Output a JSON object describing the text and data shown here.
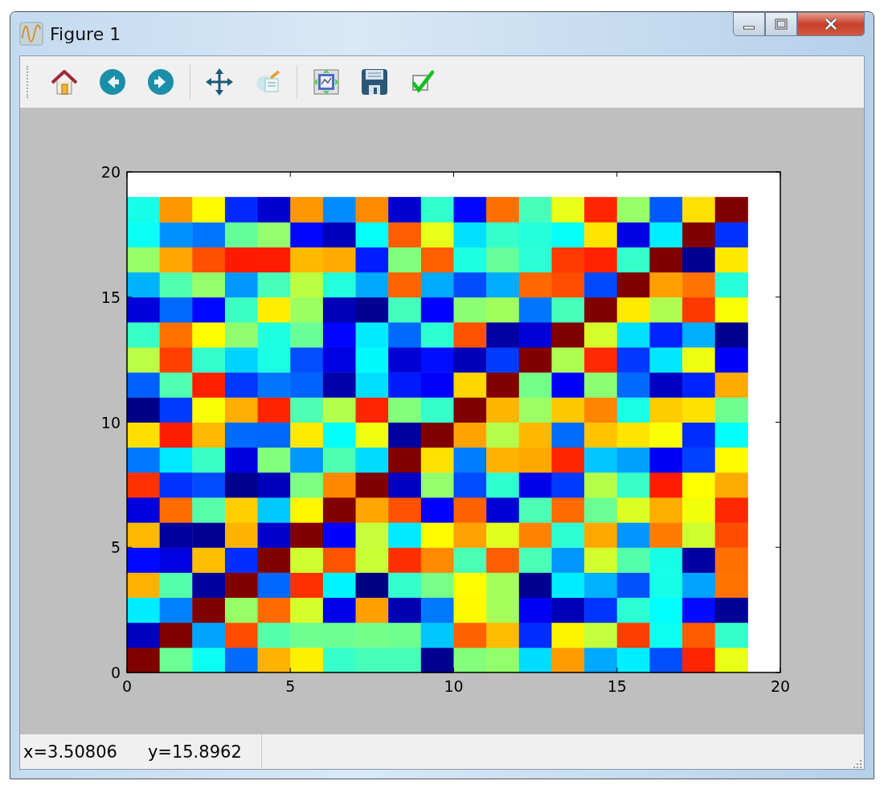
{
  "window": {
    "title": "Figure 1"
  },
  "axes": {
    "xticks": [
      "0",
      "5",
      "10",
      "15",
      "20"
    ],
    "yticks": [
      "20",
      "15",
      "10",
      "5",
      "0"
    ]
  },
  "status_bar": {
    "x_reading": "x=3.50806",
    "y_reading": "y=15.8962"
  }
}
